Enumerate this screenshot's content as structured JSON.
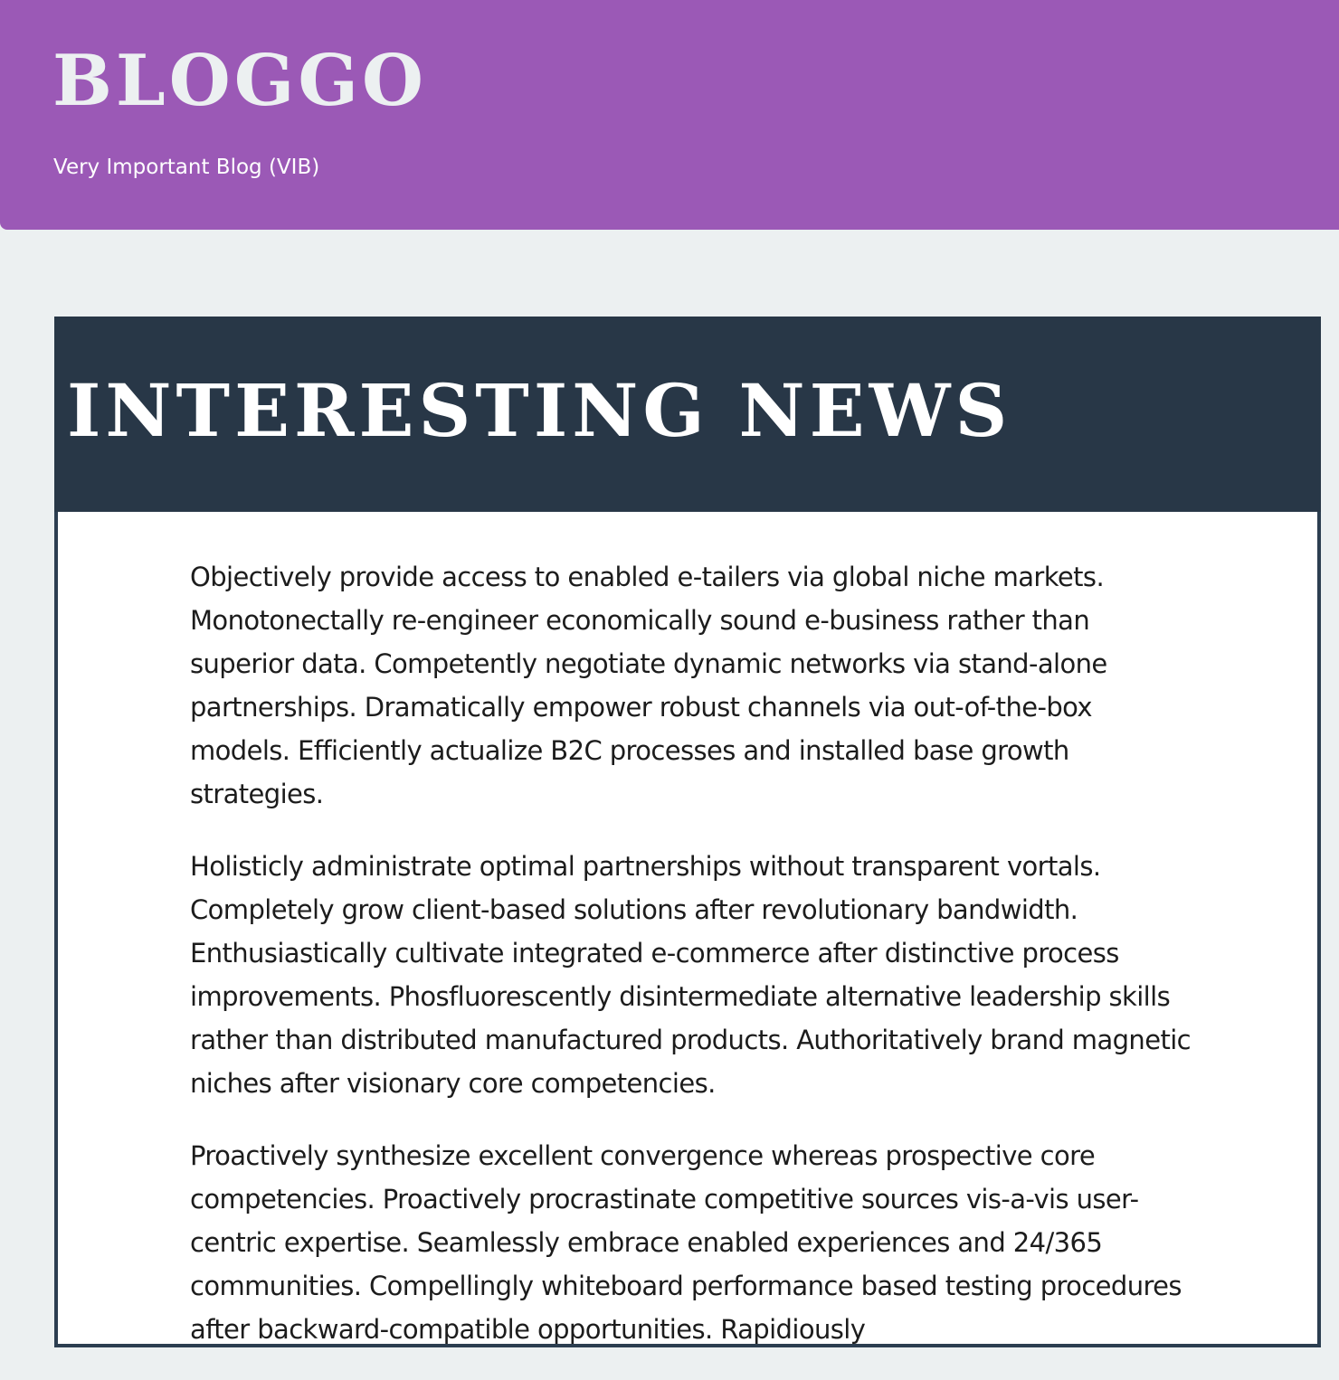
{
  "header": {
    "site_title": "BLOGGO",
    "tagline": "Very Important Blog (VIB)"
  },
  "article": {
    "title": "INTERESTING NEWS",
    "paragraphs": [
      "Objectively provide access to enabled e-tailers via global niche markets. Monotonectally re-engineer economically sound e-business rather than superior data. Competently negotiate dynamic networks via stand-alone partnerships. Dramatically empower robust channels via out-of-the-box models. Efficiently actualize B2C processes and installed base growth strategies.",
      "Holisticly administrate optimal partnerships without transparent vortals. Completely grow client-based solutions after revolutionary bandwidth. Enthusiastically cultivate integrated e-commerce after distinctive process improvements. Phosfluorescently disintermediate alternative leadership skills rather than distributed manufactured products. Authoritatively brand magnetic niches after visionary core competencies.",
      "Proactively synthesize excellent convergence whereas prospective core competencies. Proactively procrastinate competitive sources vis-a-vis user-centric expertise. Seamlessly embrace enabled experiences and 24/365 communities. Compellingly whiteboard performance based testing procedures after backward-compatible opportunities. Rapidiously"
    ]
  },
  "colors": {
    "header_bg": "#9b59b6",
    "page_bg": "#ecf0f1",
    "article_header_bg": "#283747",
    "article_border": "#2c3e50"
  }
}
